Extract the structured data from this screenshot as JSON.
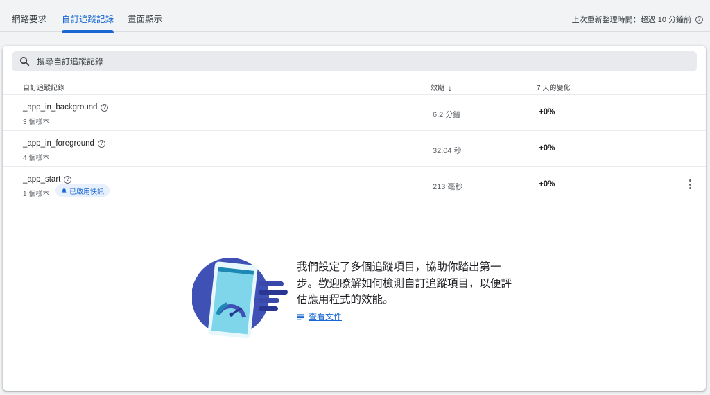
{
  "tabs": [
    {
      "label": "網路要求"
    },
    {
      "label": "自訂追蹤記錄"
    },
    {
      "label": "畫面顯示"
    }
  ],
  "refresh_status": "上次重新整理時間：超過 10 分鐘前",
  "help_glyph": "?",
  "search": {
    "placeholder": "搜尋自訂追蹤記錄",
    "value": ""
  },
  "table": {
    "headers": {
      "name": "自訂追蹤記錄",
      "duration": "效期",
      "change": "7 天的變化"
    },
    "sort_arrow": "↓",
    "rows": [
      {
        "name": "_app_in_background",
        "samples": "3 個樣本",
        "duration": "6.2 分鐘",
        "change": "+0%",
        "badge": null
      },
      {
        "name": "_app_in_foreground",
        "samples": "4 個樣本",
        "duration": "32.04 秒",
        "change": "+0%",
        "badge": null
      },
      {
        "name": "_app_start",
        "samples": "1 個樣本",
        "duration": "213 毫秒",
        "change": "+0%",
        "badge": "已啟用快訊"
      }
    ]
  },
  "empty_state": {
    "message": "我們設定了多個追蹤項目，協助你踏出第一步。歡迎瞭解如何檢測自訂追蹤項目，以便評估應用程式的效能。",
    "link_label": "查看文件"
  },
  "colors": {
    "accent": "#1967d2",
    "badge_bg": "#e8f0fe",
    "illustration_navy": "#3f51b5",
    "illustration_cyan": "#6fd3e6"
  },
  "icons": [
    "search-icon",
    "help-icon",
    "arrow-down-icon",
    "bell-icon",
    "more-vert-icon",
    "document-icon"
  ]
}
